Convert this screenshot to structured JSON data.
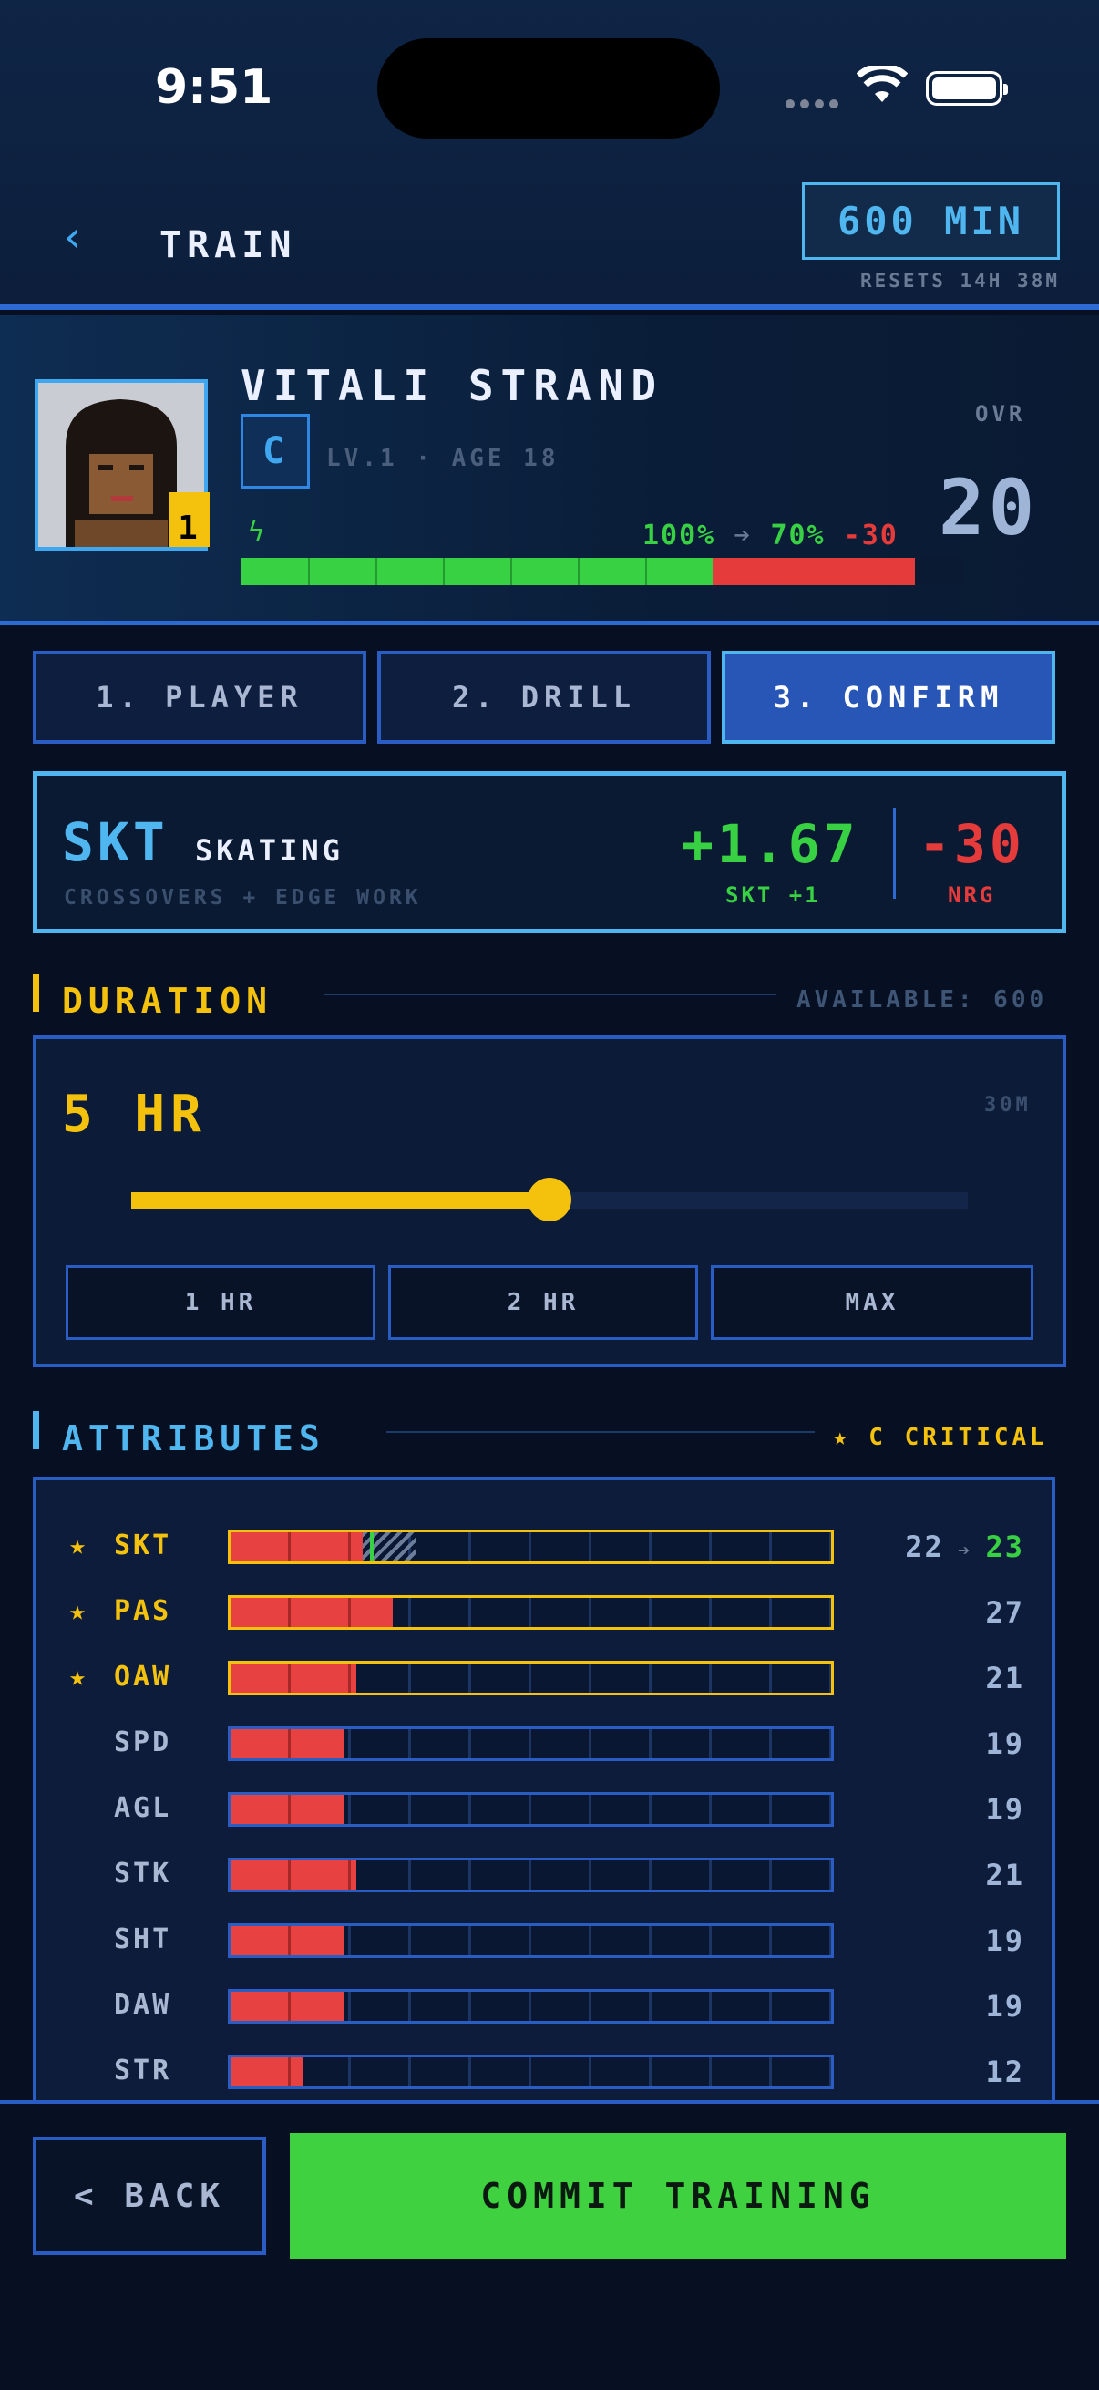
{
  "status_bar": {
    "time": "9:51"
  },
  "header": {
    "title": "TRAIN",
    "minutes": "600 MIN",
    "resets": "RESETS 14H 38M"
  },
  "player": {
    "name": "VITALI STRAND",
    "grade": "C",
    "level_age": "LV.1 · AGE 18",
    "badge": "1",
    "energy_from": "100%",
    "energy_to": "70%",
    "energy_cost": "-30",
    "energy_now": 1.0,
    "energy_after": 0.7,
    "ovr_label": "OVR",
    "ovr": "20"
  },
  "steps": [
    {
      "label": "1. PLAYER",
      "active": false
    },
    {
      "label": "2. DRILL",
      "active": false
    },
    {
      "label": "3. CONFIRM",
      "active": true
    }
  ],
  "drill": {
    "code": "SKT",
    "name": "SKATING",
    "description": "CROSSOVERS + EDGE WORK",
    "gain": "+1.67",
    "gain_label": "SKT +1",
    "cost": "-30",
    "cost_label": "NRG"
  },
  "duration": {
    "section_title": "DURATION",
    "available": "AVAILABLE: 600",
    "value": "5 HR",
    "step_label": "30M",
    "slider_fraction": 0.5,
    "quick_buttons": [
      "1 HR",
      "2 HR",
      "MAX"
    ]
  },
  "attributes": {
    "section_title": "ATTRIBUTES",
    "legend": "★ C CRITICAL",
    "scale_max": 100,
    "items": [
      {
        "code": "SKT",
        "critical": true,
        "value": 22,
        "next": 23,
        "display": "22",
        "display_next": "23"
      },
      {
        "code": "PAS",
        "critical": true,
        "value": 27,
        "display": "27"
      },
      {
        "code": "OAW",
        "critical": true,
        "value": 21,
        "display": "21"
      },
      {
        "code": "SPD",
        "critical": false,
        "value": 19,
        "display": "19"
      },
      {
        "code": "AGL",
        "critical": false,
        "value": 19,
        "display": "19"
      },
      {
        "code": "STK",
        "critical": false,
        "value": 21,
        "display": "21"
      },
      {
        "code": "SHT",
        "critical": false,
        "value": 19,
        "display": "19"
      },
      {
        "code": "DAW",
        "critical": false,
        "value": 19,
        "display": "19"
      },
      {
        "code": "STR",
        "critical": false,
        "value": 12,
        "display": "12"
      }
    ]
  },
  "footer": {
    "back_label": "< BACK",
    "commit_label": "COMMIT TRAINING"
  },
  "colors": {
    "accent": "#4fb6f0",
    "gain": "#38d143",
    "loss": "#e63b3b",
    "gold": "#f4c20d",
    "border": "#2a5dc4"
  }
}
